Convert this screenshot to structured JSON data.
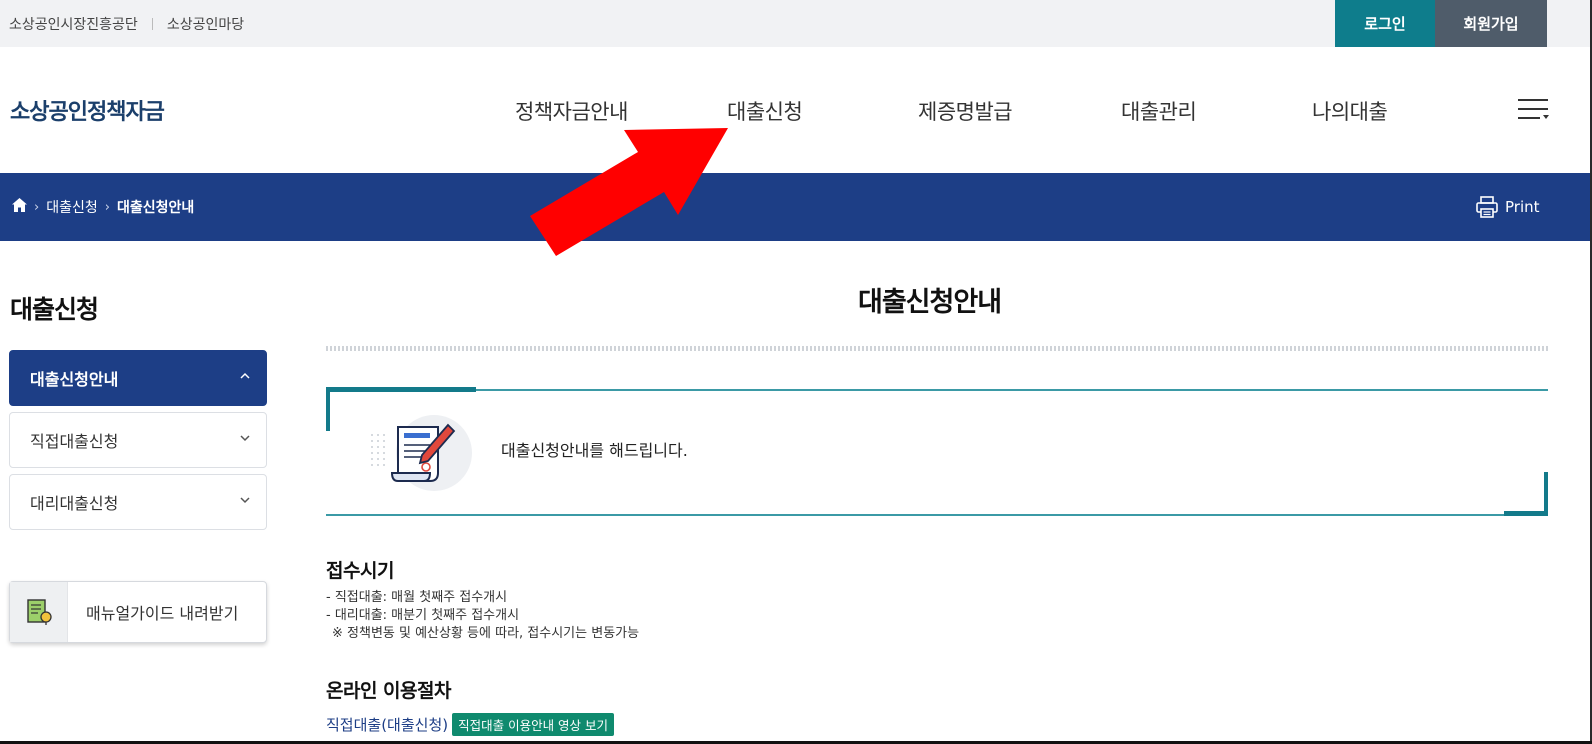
{
  "topbar": {
    "links": [
      "소상공인시장진흥공단",
      "소상공인마당"
    ],
    "login_label": "로그인",
    "join_label": "회원가입"
  },
  "header": {
    "logo": "소상공인정책자금",
    "menu": [
      "정책자금안내",
      "대출신청",
      "제증명발급",
      "대출관리",
      "나의대출"
    ],
    "hamburger_icon": "hamburger-icon"
  },
  "breadcrumb": {
    "home_icon": "home-icon",
    "items": [
      "대출신청",
      "대출신청안내"
    ],
    "print_label": "Print"
  },
  "sidebar": {
    "title": "대출신청",
    "items": [
      {
        "label": "대출신청안내",
        "expanded": true
      },
      {
        "label": "직접대출신청",
        "expanded": false
      },
      {
        "label": "대리대출신청",
        "expanded": false
      }
    ],
    "manual_label": "매뉴얼가이드 내려받기"
  },
  "main": {
    "title": "대출신청안내",
    "intro": "대출신청안내를 해드립니다.",
    "sections": [
      {
        "title": "접수시기",
        "lines": [
          "- 직접대출: 매월 첫째주 접수개시",
          "- 대리대출: 매분기 첫째주 접수개시",
          "※ 정책변동 및 예산상황 등에 따라, 접수시기는 변동가능"
        ]
      },
      {
        "title": "온라인 이용절차",
        "link": "직접대출(대출신청)",
        "tag": "직접대출 이용안내 영상 보기"
      }
    ]
  },
  "colors": {
    "navy": "#1d3e86",
    "teal": "#0e7d8c",
    "slate": "#4f5c6a",
    "green_tag": "#0f8a6e",
    "annotation_arrow": "#ff0000"
  }
}
